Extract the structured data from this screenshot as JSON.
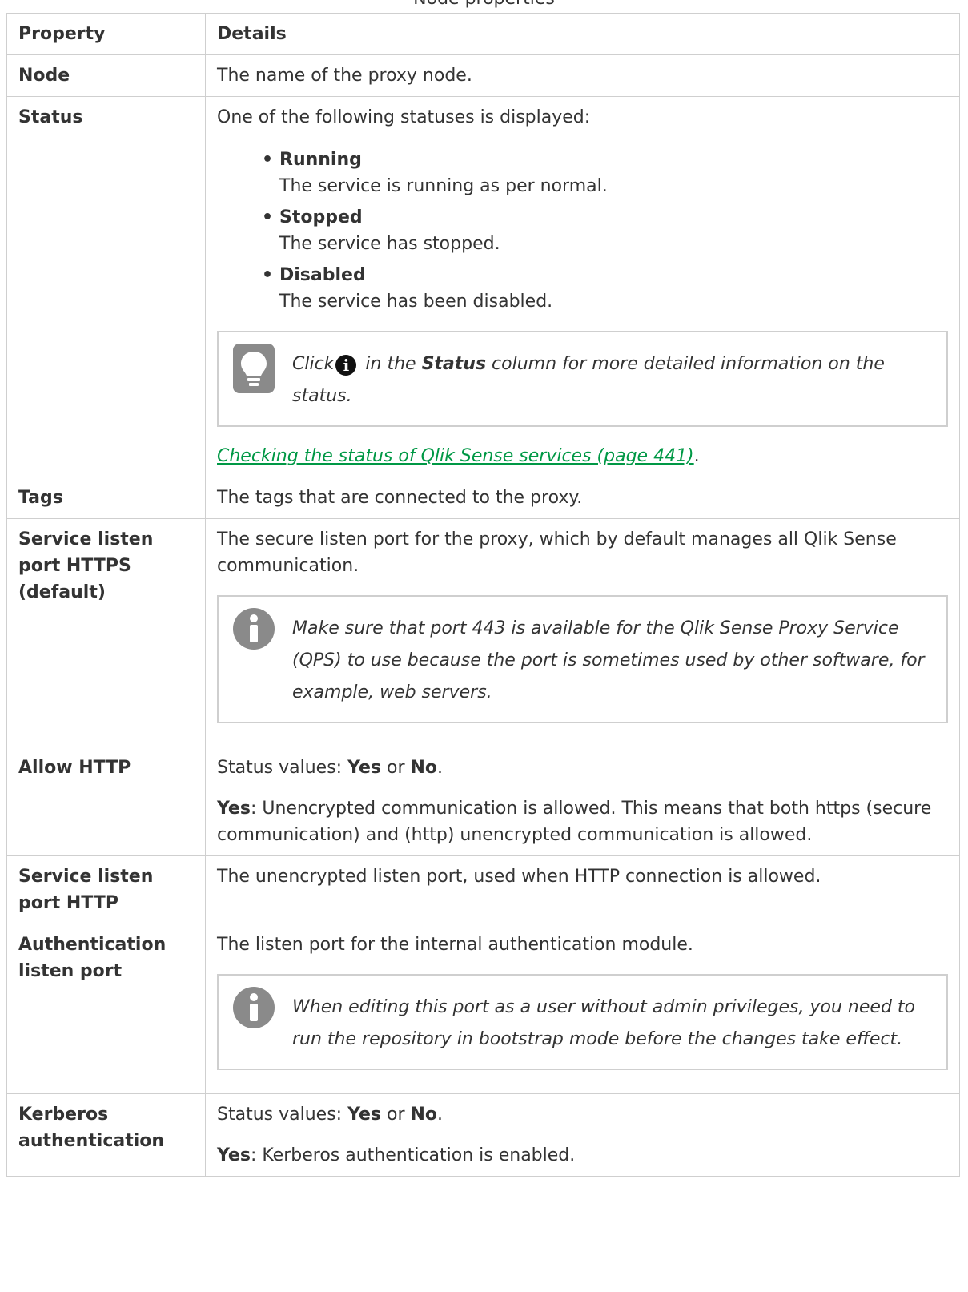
{
  "caption": "Node properties",
  "table": {
    "headers": [
      "Property",
      "Details"
    ],
    "rows": {
      "node": {
        "property": "Node",
        "details": "The name of the proxy node."
      },
      "status": {
        "property": "Status",
        "intro": "One of the following statuses is displayed:",
        "items": [
          {
            "name": "Running",
            "desc": "The service is running as per normal."
          },
          {
            "name": "Stopped",
            "desc": "The service has stopped."
          },
          {
            "name": "Disabled",
            "desc": "The service has been disabled."
          }
        ],
        "tip": {
          "pre": "Click",
          "mid": " in the ",
          "bold": "Status",
          "post": " column for more detailed information on the status."
        },
        "link": "Checking the status of Qlik Sense services (page 441)",
        "link_suffix": "."
      },
      "tags": {
        "property": "Tags",
        "details": "The tags that are connected to the proxy."
      },
      "https": {
        "property": "Service listen port HTTPS (default)",
        "details": "The secure listen port for the proxy, which by default manages all Qlik Sense communication.",
        "note": "Make sure that port 443 is available for the Qlik Sense Proxy Service (QPS) to use because the port is sometimes used by other software, for example, web servers."
      },
      "allow_http": {
        "property": "Allow HTTP",
        "sv_label": "Status values: ",
        "yes": "Yes",
        "or": " or ",
        "no": "No",
        "dot": ".",
        "yes_label": "Yes",
        "yes_desc": ": Unencrypted communication is allowed. This means that both https (secure communication) and (http) unencrypted communication is allowed."
      },
      "http_port": {
        "property": "Service listen port HTTP",
        "details": "The unencrypted listen port, used when HTTP connection is allowed."
      },
      "auth_port": {
        "property": "Authentication listen port",
        "details": "The listen port for the internal authentication module.",
        "note": "When editing this port as a user without admin privileges, you need to run the repository in bootstrap mode before the changes take effect."
      },
      "kerberos": {
        "property": "Kerberos authentication",
        "sv_label": "Status values: ",
        "yes": "Yes",
        "or": " or ",
        "no": "No",
        "dot": ".",
        "yes_label": "Yes",
        "yes_desc": ": Kerberos authentication is enabled."
      }
    }
  },
  "colors": {
    "link": "#009845",
    "border": "#cfcfcf",
    "icon": "#8a8a8a"
  },
  "icons": [
    "lightbulb-icon",
    "info-icon",
    "info-circle-icon"
  ]
}
